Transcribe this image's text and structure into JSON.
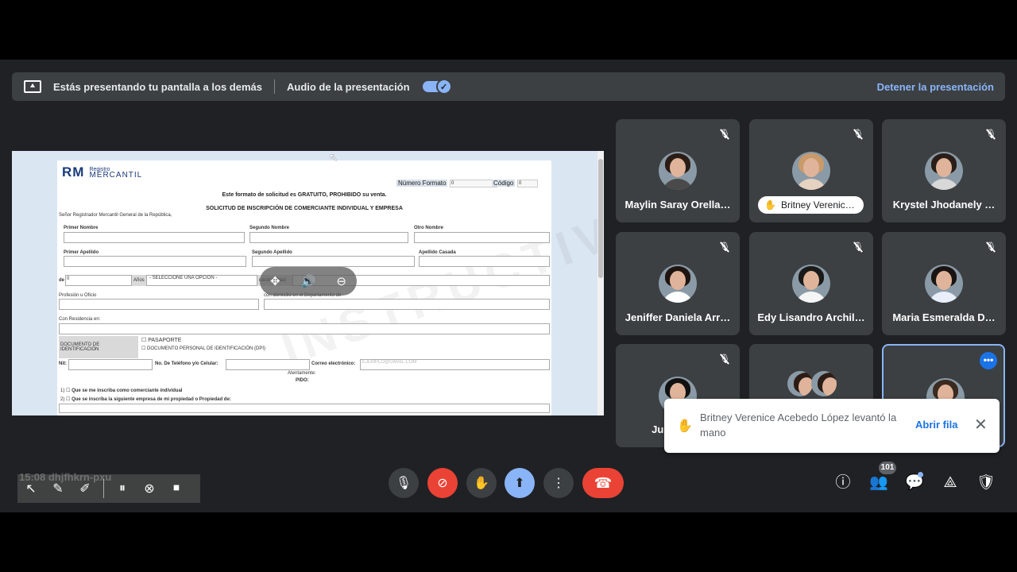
{
  "banner": {
    "presenting_text": "Estás presentando tu pantalla a los demás",
    "audio_label": "Audio de la presentación",
    "stop_label": "Detener la presentación"
  },
  "document": {
    "logo_abbr": "RM",
    "logo_line1": "Registro",
    "logo_line2": "MERCANTIL",
    "numero_formato": "Número Formato",
    "numero_formato_value": "0",
    "codigo": "Código",
    "codigo_value": "0",
    "line_gratuito": "Este formato de solicitud es GRATUITO, PROHIBIDO su venta.",
    "title": "SOLICITUD DE INSCRIPCIÓN DE COMERCIANTE INDIVIDUAL Y EMPRESA",
    "greeting": "Señor Registrador Mercantil General de la República,",
    "primer_nombre": "Primer Nombre",
    "segundo_nombre": "Segundo Nombre",
    "otro_nombre": "Otro Nombre",
    "primer_apellido": "Primer Apellido",
    "segundo_apellido": "Segundo Apellido",
    "apellido_casada": "Apellido Casada",
    "de": "de",
    "edad_value": "0",
    "anios": "Años",
    "seleccione": "- SELECCIONE UNA OPCION -",
    "estado_civil": "nacionalidad",
    "profesion": "Profesión u Oficio",
    "domicilio": "con domicilio en el Departamento de",
    "residencia": "Con Residencia en:",
    "doc_identificacion": "DOCUMENTO DE IDENTIFICACIÓN",
    "pasaporte": "PASAPORTE",
    "dpi": "DOCUMENTO PERSONAL DE IDENTIFICACIÓN (DPI)",
    "nit": "Nit:",
    "telefono": "No. De Teléfono y/o Celular:",
    "correo": "Correo electrónico:",
    "correo_placeholder": "EJEMPLO@GMAIL.COM",
    "atentamente": "Atentamente:",
    "pido": "PIDO:",
    "op1_num": "1)",
    "op1": "Que se me inscriba como comerciante individual",
    "op2_num": "2)",
    "op2": "Que se inscriba la siguiente empresa de mi propiedad o Propiedad de:",
    "watermark": "INSTRUCTIVO"
  },
  "participants": [
    {
      "name": "Maylin Saray Orella…",
      "hair": "#2b1d16",
      "body": "#4a4a4a"
    },
    {
      "name": "Britney Verenic…",
      "hair": "#c99a6a",
      "body": "#e6d2c0",
      "hand_raised": true
    },
    {
      "name": "Krystel Jhodanely …",
      "hair": "#2a1e18",
      "body": "#d8d8d8"
    },
    {
      "name": "Jeniffer Daniela Arr…",
      "hair": "#1e1410",
      "body": "#ffffff"
    },
    {
      "name": "Edy Lisandro Archil…",
      "hair": "#1a1a1a",
      "body": "#f5f5f5"
    },
    {
      "name": "Maria Esmeralda D…",
      "hair": "#1a1412",
      "body": "#e9eefa"
    },
    {
      "name": "Junior D…",
      "hair": "#111111",
      "body": "#c0272d"
    },
    {
      "name": "",
      "hair": "#2b1d16",
      "body": "#c0272d"
    },
    {
      "name": "",
      "hair": "#3a2a20",
      "body": "#666666"
    }
  ],
  "toast": {
    "message": "Britney Verenice Acebedo López levantó la mano",
    "action": "Abrir fila"
  },
  "bottom": {
    "participants_count": "101"
  },
  "drawbar": {
    "ghost_text": "15:08  dhjfhkrn-pxu"
  }
}
